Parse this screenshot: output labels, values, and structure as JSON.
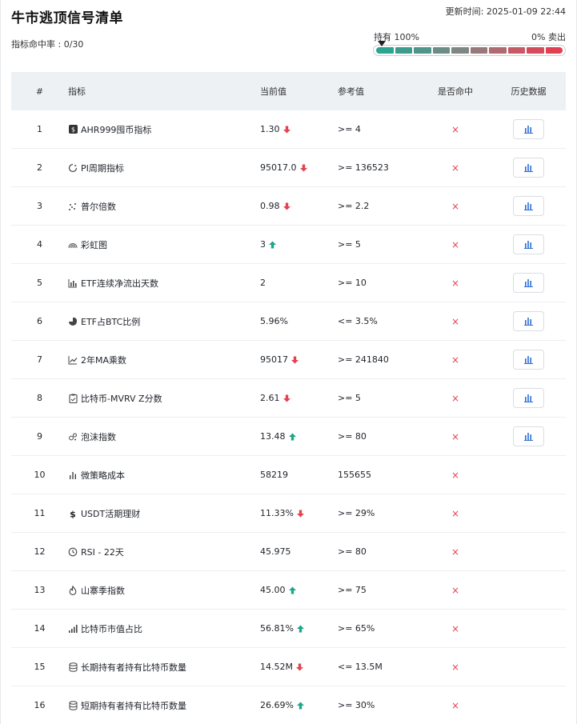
{
  "header": {
    "title": "牛市逃顶信号清单",
    "updated": "更新时间: 2025-01-09 22:44",
    "hit_rate": "指标命中率 : 0/30"
  },
  "gauge": {
    "hold_label": "持有 100%",
    "sell_label": "0% 卖出",
    "pointer_fraction": 0.03,
    "segment_colors": [
      "#2aa58f",
      "#3d9c8e",
      "#4f9589",
      "#6a8e87",
      "#7e8782",
      "#98787a",
      "#b06a71",
      "#c65a66",
      "#d64b5c",
      "#e23f53"
    ]
  },
  "table": {
    "headers": {
      "index": "#",
      "name": "指标",
      "current": "当前值",
      "reference": "参考值",
      "hit": "是否命中",
      "history": "历史数据"
    },
    "rows": [
      {
        "index": "1",
        "icon": "ahr-square-icon",
        "name": "AHR999囤币指标",
        "current": "1.30",
        "trend": "down",
        "reference": ">= 4",
        "hit": "×",
        "history": true
      },
      {
        "index": "2",
        "icon": "pi-cycle-icon",
        "name": "PI周期指标",
        "current": "95017.0",
        "trend": "down",
        "reference": ">= 136523",
        "hit": "×",
        "history": true
      },
      {
        "index": "3",
        "icon": "mayer-scatter-icon",
        "name": "普尔倍数",
        "current": "0.98",
        "trend": "down",
        "reference": ">= 2.2",
        "hit": "×",
        "history": true
      },
      {
        "index": "4",
        "icon": "rainbow-icon",
        "name": "彩虹图",
        "current": "3",
        "trend": "up",
        "reference": ">= 5",
        "hit": "×",
        "history": true
      },
      {
        "index": "5",
        "icon": "bar-chart-icon",
        "name": "ETF连续净流出天数",
        "current": "2",
        "trend": "",
        "reference": ">= 10",
        "hit": "×",
        "history": true
      },
      {
        "index": "6",
        "icon": "pie-chart-icon",
        "name": "ETF占BTC比例",
        "current": "5.96%",
        "trend": "",
        "reference": "<= 3.5%",
        "hit": "×",
        "history": true
      },
      {
        "index": "7",
        "icon": "line-chart-icon",
        "name": "2年MA乘数",
        "current": "95017",
        "trend": "down",
        "reference": ">= 241840",
        "hit": "×",
        "history": true
      },
      {
        "index": "8",
        "icon": "clipboard-icon",
        "name": "比特币-MVRV Z分数",
        "current": "2.61",
        "trend": "down",
        "reference": ">= 5",
        "hit": "×",
        "history": true
      },
      {
        "index": "9",
        "icon": "bubble-icon",
        "name": "泡沫指数",
        "current": "13.48",
        "trend": "up",
        "reference": ">= 80",
        "hit": "×",
        "history": true
      },
      {
        "index": "10",
        "icon": "small-bars-icon",
        "name": "微策略成本",
        "current": "58219",
        "trend": "",
        "reference": "155655",
        "hit": "×",
        "history": false
      },
      {
        "index": "11",
        "icon": "dollar-icon",
        "name": "USDT活期理财",
        "current": "11.33%",
        "trend": "down",
        "reference": ">= 29%",
        "hit": "×",
        "history": false
      },
      {
        "index": "12",
        "icon": "clock-icon",
        "name": "RSI - 22天",
        "current": "45.975",
        "trend": "",
        "reference": ">= 80",
        "hit": "×",
        "history": false
      },
      {
        "index": "13",
        "icon": "flame-icon",
        "name": "山寨季指数",
        "current": "45.00",
        "trend": "up",
        "reference": ">= 75",
        "hit": "×",
        "history": false
      },
      {
        "index": "14",
        "icon": "signal-bars-icon",
        "name": "比特币市值占比",
        "current": "56.81%",
        "trend": "up",
        "reference": ">= 65%",
        "hit": "×",
        "history": false
      },
      {
        "index": "15",
        "icon": "database-icon",
        "name": "长期持有者持有比特币数量",
        "current": "14.52M",
        "trend": "down",
        "reference": "<= 13.5M",
        "hit": "×",
        "history": false
      },
      {
        "index": "16",
        "icon": "database-icon",
        "name": "短期持有者持有比特币数量",
        "current": "26.69%",
        "trend": "up",
        "reference": ">= 30%",
        "hit": "×",
        "history": false
      }
    ]
  },
  "colors": {
    "trend_up": "#1ea58a",
    "trend_down": "#e2434f",
    "miss_mark": "#e2434f",
    "history_icon": "#2f6fd6"
  }
}
